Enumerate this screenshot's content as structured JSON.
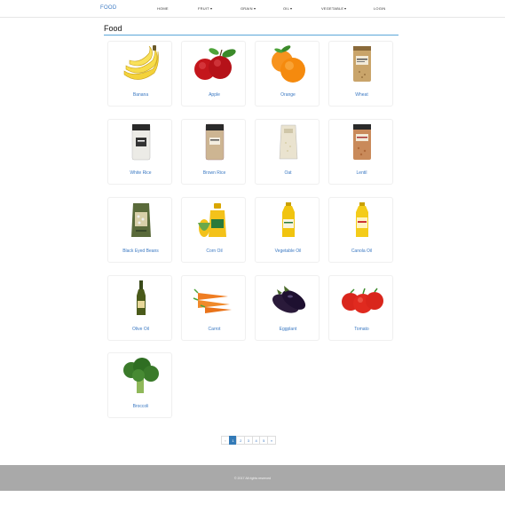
{
  "navbar": {
    "brand": "FOOD",
    "items": [
      {
        "label": "HOME",
        "has_caret": false
      },
      {
        "label": "FRUIT",
        "has_caret": true
      },
      {
        "label": "GRAIN",
        "has_caret": true
      },
      {
        "label": "OIL",
        "has_caret": true
      },
      {
        "label": "VEGETABLE",
        "has_caret": true
      },
      {
        "label": "LOGIN",
        "has_caret": false
      }
    ]
  },
  "page": {
    "title": "Food"
  },
  "products": [
    {
      "name": "Banana",
      "icon": "banana-icon"
    },
    {
      "name": "Apple",
      "icon": "apple-icon"
    },
    {
      "name": "Orange",
      "icon": "orange-icon"
    },
    {
      "name": "Wheat",
      "icon": "wheat-bag-icon"
    },
    {
      "name": "White Rice",
      "icon": "white-rice-bag-icon"
    },
    {
      "name": "Brown Rice",
      "icon": "brown-rice-bag-icon"
    },
    {
      "name": "Oat",
      "icon": "oat-bag-icon"
    },
    {
      "name": "Lentil",
      "icon": "lentil-bag-icon"
    },
    {
      "name": "Black Eyed Beans",
      "icon": "beans-bag-icon"
    },
    {
      "name": "Corn Oil",
      "icon": "corn-oil-icon"
    },
    {
      "name": "Vegetable Oil",
      "icon": "vegetable-oil-icon"
    },
    {
      "name": "Canola Oil",
      "icon": "canola-oil-icon"
    },
    {
      "name": "Olive Oil",
      "icon": "olive-oil-icon"
    },
    {
      "name": "Carrot",
      "icon": "carrot-icon"
    },
    {
      "name": "Eggplant",
      "icon": "eggplant-icon"
    },
    {
      "name": "Tomato",
      "icon": "tomato-icon"
    },
    {
      "name": "Broccoli",
      "icon": "broccoli-icon"
    }
  ],
  "pagination": {
    "prev": "«",
    "pages": [
      "1",
      "2",
      "3",
      "4",
      "5"
    ],
    "next": "»",
    "current": "1"
  },
  "footer": {
    "text": "© 2017 All rights reserved"
  },
  "colors": {
    "accent": "#3a78c2",
    "title_rule": "#5ba6d9",
    "active_page": "#337ab7",
    "footer_bg": "#a9a9a9"
  }
}
